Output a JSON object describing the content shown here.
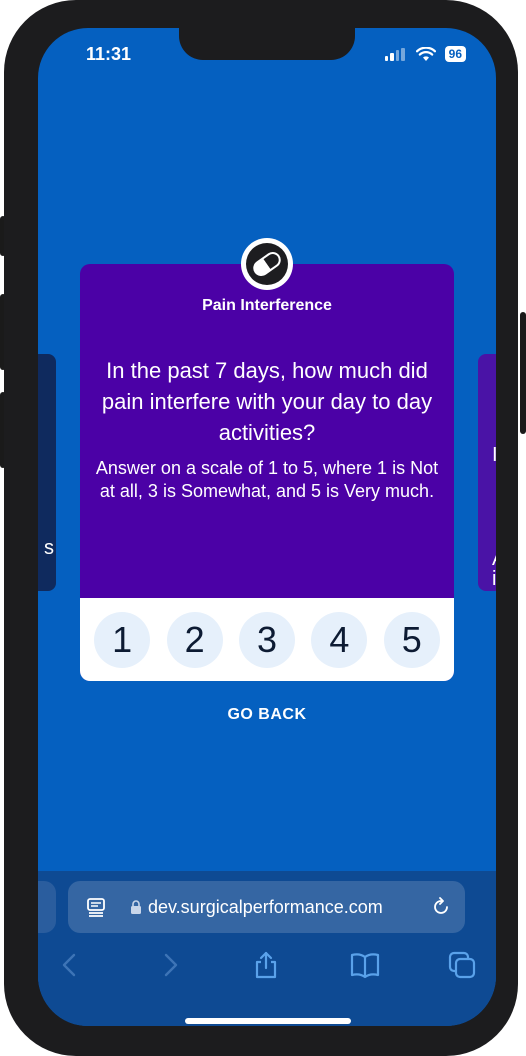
{
  "status_bar": {
    "time": "11:31",
    "battery": "96"
  },
  "side_cards": {
    "left_fragment": "s",
    "right_fragment_top": "I",
    "right_fragment_mid": "A",
    "right_fragment_low": "i"
  },
  "question_card": {
    "icon": "pill-icon",
    "category": "Pain Interference",
    "question": "In the past 7 days, how much did pain interfere with your day to day activities?",
    "instruction": "Answer on a scale of 1 to 5, where 1 is Not at all, 3 is Somewhat, and 5 is Very much.",
    "scale_options": [
      "1",
      "2",
      "3",
      "4",
      "5"
    ]
  },
  "go_back_label": "GO BACK",
  "browser": {
    "url": "dev.surgicalperformance.com",
    "toolbar_icons": [
      "back-icon",
      "forward-icon",
      "share-icon",
      "bookmarks-icon",
      "tabs-icon"
    ]
  },
  "colors": {
    "background": "#0560c0",
    "card": "#4b01a6",
    "scale_button": "#e6f0fb",
    "browser_bar": "#0e4a93"
  }
}
